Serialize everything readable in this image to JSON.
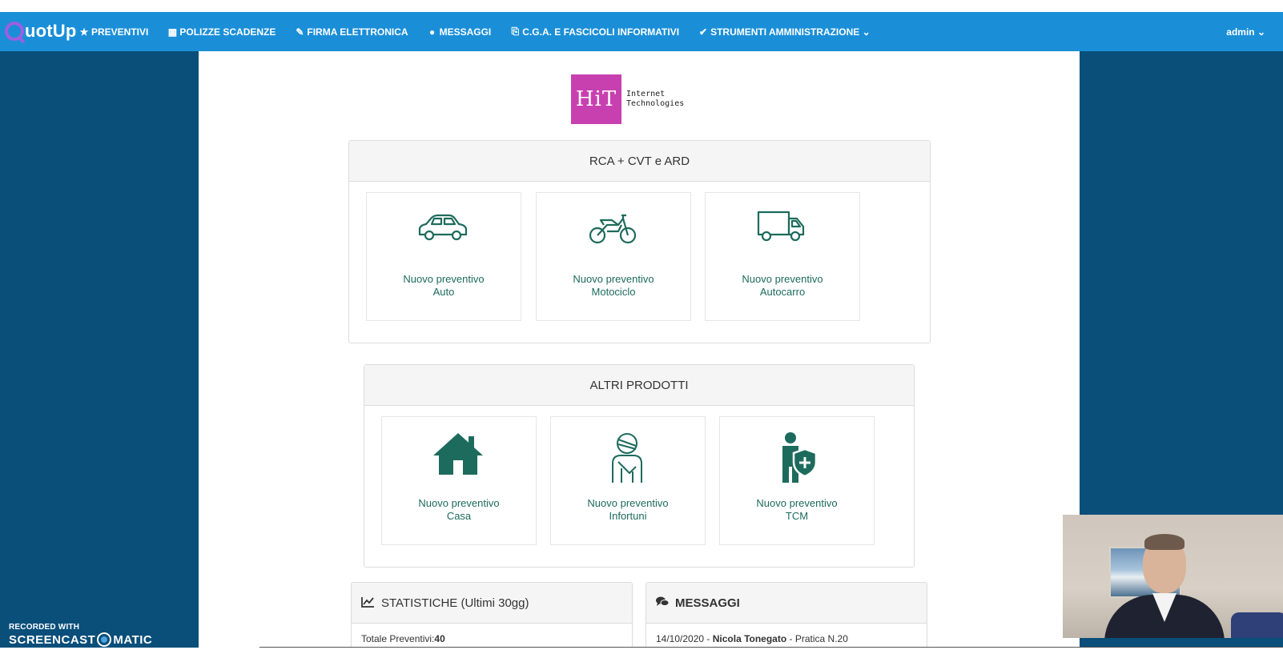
{
  "navbar": {
    "brand": "uotUp",
    "items": [
      {
        "icon": "star-icon",
        "glyph": "★",
        "label": "PREVENTIVI"
      },
      {
        "icon": "calendar-icon",
        "glyph": "▦",
        "label": "POLIZZE SCADENZE"
      },
      {
        "icon": "edit-icon",
        "glyph": "✎",
        "label": "FIRMA ELETTRONICA"
      },
      {
        "icon": "chat-icon",
        "glyph": "●",
        "label": "MESSAGGI"
      },
      {
        "icon": "pdf-icon",
        "glyph": "⎘",
        "label": "C.G.A. E FASCICOLI INFORMATIVI"
      },
      {
        "icon": "wrench-icon",
        "glyph": "✔",
        "label": "STRUMENTI AMMINISTRAZIONE ⌄"
      }
    ],
    "user": "admin ⌄"
  },
  "logo": {
    "mark": "HiT",
    "line1": "Internet",
    "line2": "Technologies"
  },
  "rca_panel": {
    "title": "RCA + CVT e ARD",
    "tiles": [
      {
        "icon": "car-icon",
        "line1": "Nuovo preventivo",
        "line2": "Auto"
      },
      {
        "icon": "motorcycle-icon",
        "line1": "Nuovo preventivo",
        "line2": "Motociclo"
      },
      {
        "icon": "truck-icon",
        "line1": "Nuovo preventivo",
        "line2": "Autocarro"
      }
    ]
  },
  "altri_panel": {
    "title": "ALTRI PRODOTTI",
    "tiles": [
      {
        "icon": "house-icon",
        "line1": "Nuovo preventivo",
        "line2": "Casa"
      },
      {
        "icon": "injured-person-icon",
        "line1": "Nuovo preventivo",
        "line2": "Infortuni"
      },
      {
        "icon": "person-shield-icon",
        "line1": "Nuovo preventivo",
        "line2": "TCM"
      }
    ]
  },
  "stats": {
    "title": "STATISTICHE (Ultimi 30gg)",
    "total_label": "Totale Preventivi:",
    "total_value": "40"
  },
  "messages": {
    "title": "MESSAGGI",
    "items": [
      {
        "date": "14/10/2020",
        "sep1": " - ",
        "author": "Nicola Tonegato",
        "sep2": " - ",
        "ref": "Pratica N.20"
      }
    ]
  },
  "watermark": {
    "top": "RECORDED WITH",
    "left": "SCREENCAST",
    "right": "MATIC"
  },
  "colors": {
    "navbar": "#1a8fd8",
    "side": "#0a4e7a",
    "tile_text": "#1d6b5c",
    "logo": "#c840b0"
  }
}
